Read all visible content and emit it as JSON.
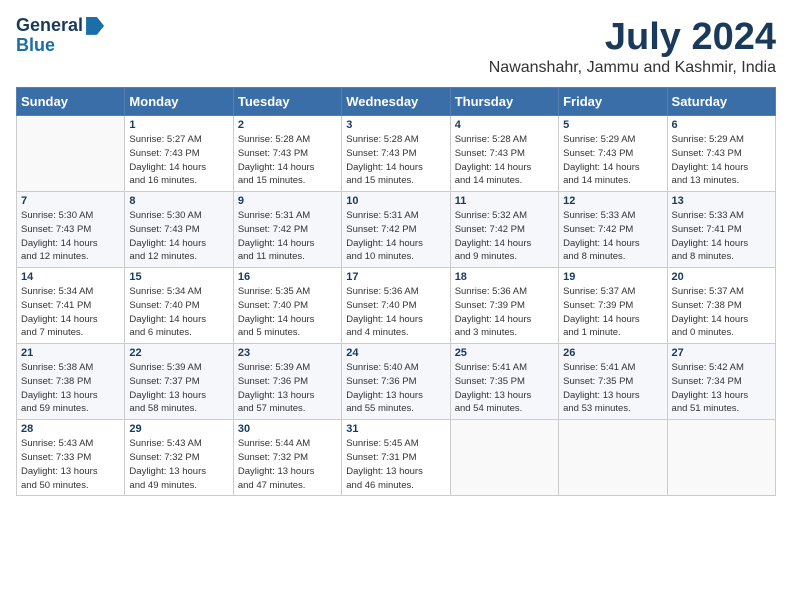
{
  "header": {
    "logo_general": "General",
    "logo_blue": "Blue",
    "title": "July 2024",
    "subtitle": "Nawanshahr, Jammu and Kashmir, India"
  },
  "columns": [
    "Sunday",
    "Monday",
    "Tuesday",
    "Wednesday",
    "Thursday",
    "Friday",
    "Saturday"
  ],
  "weeks": [
    [
      {
        "day": "",
        "info": ""
      },
      {
        "day": "1",
        "info": "Sunrise: 5:27 AM\nSunset: 7:43 PM\nDaylight: 14 hours\nand 16 minutes."
      },
      {
        "day": "2",
        "info": "Sunrise: 5:28 AM\nSunset: 7:43 PM\nDaylight: 14 hours\nand 15 minutes."
      },
      {
        "day": "3",
        "info": "Sunrise: 5:28 AM\nSunset: 7:43 PM\nDaylight: 14 hours\nand 15 minutes."
      },
      {
        "day": "4",
        "info": "Sunrise: 5:28 AM\nSunset: 7:43 PM\nDaylight: 14 hours\nand 14 minutes."
      },
      {
        "day": "5",
        "info": "Sunrise: 5:29 AM\nSunset: 7:43 PM\nDaylight: 14 hours\nand 14 minutes."
      },
      {
        "day": "6",
        "info": "Sunrise: 5:29 AM\nSunset: 7:43 PM\nDaylight: 14 hours\nand 13 minutes."
      }
    ],
    [
      {
        "day": "7",
        "info": "Sunrise: 5:30 AM\nSunset: 7:43 PM\nDaylight: 14 hours\nand 12 minutes."
      },
      {
        "day": "8",
        "info": "Sunrise: 5:30 AM\nSunset: 7:43 PM\nDaylight: 14 hours\nand 12 minutes."
      },
      {
        "day": "9",
        "info": "Sunrise: 5:31 AM\nSunset: 7:42 PM\nDaylight: 14 hours\nand 11 minutes."
      },
      {
        "day": "10",
        "info": "Sunrise: 5:31 AM\nSunset: 7:42 PM\nDaylight: 14 hours\nand 10 minutes."
      },
      {
        "day": "11",
        "info": "Sunrise: 5:32 AM\nSunset: 7:42 PM\nDaylight: 14 hours\nand 9 minutes."
      },
      {
        "day": "12",
        "info": "Sunrise: 5:33 AM\nSunset: 7:42 PM\nDaylight: 14 hours\nand 8 minutes."
      },
      {
        "day": "13",
        "info": "Sunrise: 5:33 AM\nSunset: 7:41 PM\nDaylight: 14 hours\nand 8 minutes."
      }
    ],
    [
      {
        "day": "14",
        "info": "Sunrise: 5:34 AM\nSunset: 7:41 PM\nDaylight: 14 hours\nand 7 minutes."
      },
      {
        "day": "15",
        "info": "Sunrise: 5:34 AM\nSunset: 7:40 PM\nDaylight: 14 hours\nand 6 minutes."
      },
      {
        "day": "16",
        "info": "Sunrise: 5:35 AM\nSunset: 7:40 PM\nDaylight: 14 hours\nand 5 minutes."
      },
      {
        "day": "17",
        "info": "Sunrise: 5:36 AM\nSunset: 7:40 PM\nDaylight: 14 hours\nand 4 minutes."
      },
      {
        "day": "18",
        "info": "Sunrise: 5:36 AM\nSunset: 7:39 PM\nDaylight: 14 hours\nand 3 minutes."
      },
      {
        "day": "19",
        "info": "Sunrise: 5:37 AM\nSunset: 7:39 PM\nDaylight: 14 hours\nand 1 minute."
      },
      {
        "day": "20",
        "info": "Sunrise: 5:37 AM\nSunset: 7:38 PM\nDaylight: 14 hours\nand 0 minutes."
      }
    ],
    [
      {
        "day": "21",
        "info": "Sunrise: 5:38 AM\nSunset: 7:38 PM\nDaylight: 13 hours\nand 59 minutes."
      },
      {
        "day": "22",
        "info": "Sunrise: 5:39 AM\nSunset: 7:37 PM\nDaylight: 13 hours\nand 58 minutes."
      },
      {
        "day": "23",
        "info": "Sunrise: 5:39 AM\nSunset: 7:36 PM\nDaylight: 13 hours\nand 57 minutes."
      },
      {
        "day": "24",
        "info": "Sunrise: 5:40 AM\nSunset: 7:36 PM\nDaylight: 13 hours\nand 55 minutes."
      },
      {
        "day": "25",
        "info": "Sunrise: 5:41 AM\nSunset: 7:35 PM\nDaylight: 13 hours\nand 54 minutes."
      },
      {
        "day": "26",
        "info": "Sunrise: 5:41 AM\nSunset: 7:35 PM\nDaylight: 13 hours\nand 53 minutes."
      },
      {
        "day": "27",
        "info": "Sunrise: 5:42 AM\nSunset: 7:34 PM\nDaylight: 13 hours\nand 51 minutes."
      }
    ],
    [
      {
        "day": "28",
        "info": "Sunrise: 5:43 AM\nSunset: 7:33 PM\nDaylight: 13 hours\nand 50 minutes."
      },
      {
        "day": "29",
        "info": "Sunrise: 5:43 AM\nSunset: 7:32 PM\nDaylight: 13 hours\nand 49 minutes."
      },
      {
        "day": "30",
        "info": "Sunrise: 5:44 AM\nSunset: 7:32 PM\nDaylight: 13 hours\nand 47 minutes."
      },
      {
        "day": "31",
        "info": "Sunrise: 5:45 AM\nSunset: 7:31 PM\nDaylight: 13 hours\nand 46 minutes."
      },
      {
        "day": "",
        "info": ""
      },
      {
        "day": "",
        "info": ""
      },
      {
        "day": "",
        "info": ""
      }
    ]
  ]
}
